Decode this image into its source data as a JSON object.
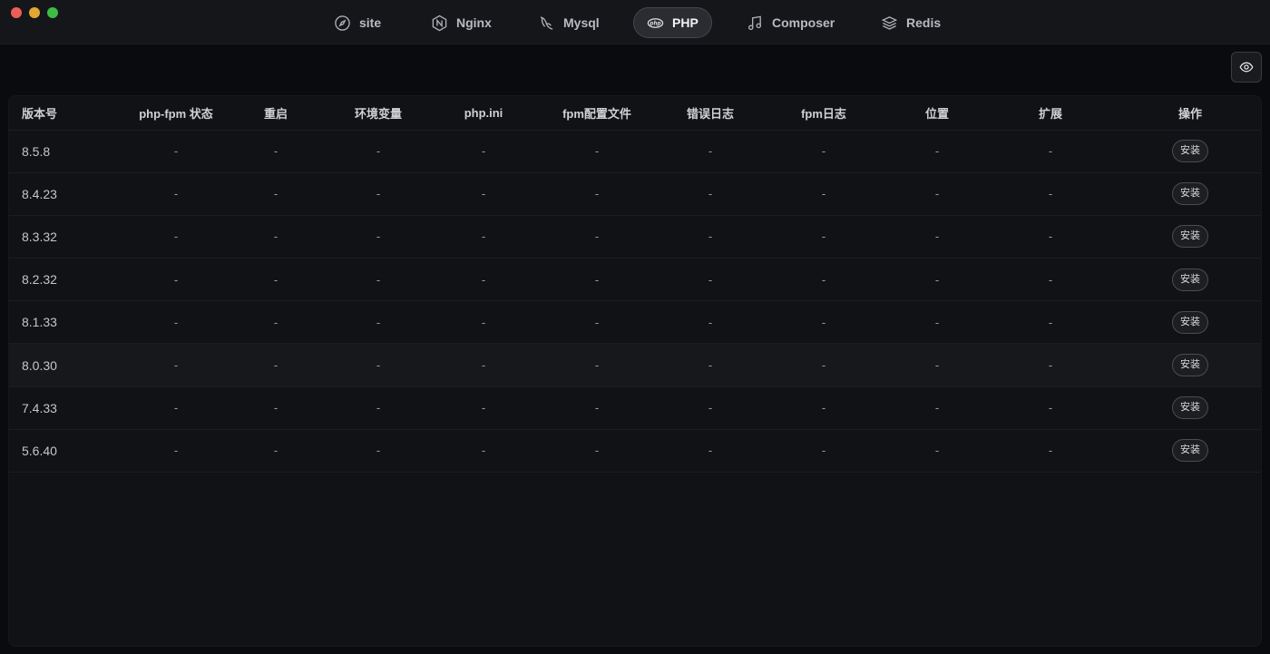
{
  "tabs": [
    {
      "label": "site",
      "icon": "compass-icon",
      "active": false
    },
    {
      "label": "Nginx",
      "icon": "nginx-icon",
      "active": false
    },
    {
      "label": "Mysql",
      "icon": "dolphin-icon",
      "active": false
    },
    {
      "label": "PHP",
      "icon": "php-icon",
      "active": true
    },
    {
      "label": "Composer",
      "icon": "music-note-icon",
      "active": false
    },
    {
      "label": "Redis",
      "icon": "layers-icon",
      "active": false
    }
  ],
  "table": {
    "headers": [
      "版本号",
      "php-fpm 状态",
      "重启",
      "环境变量",
      "php.ini",
      "fpm配置文件",
      "错误日志",
      "fpm日志",
      "位置",
      "扩展",
      "操作"
    ],
    "placeholder": "-",
    "action_label": "安装",
    "rows": [
      {
        "version": "8.5.8"
      },
      {
        "version": "8.4.23"
      },
      {
        "version": "8.3.32"
      },
      {
        "version": "8.2.32"
      },
      {
        "version": "8.1.33"
      },
      {
        "version": "8.0.30"
      },
      {
        "version": "7.4.33"
      },
      {
        "version": "5.6.40"
      }
    ]
  },
  "colors": {
    "background": "#0a0b0e",
    "titlebar": "#15161a",
    "active_tab": "#2b2c31",
    "close": "#ec5f56",
    "minimize": "#e0a830",
    "maximize": "#3fba45"
  }
}
